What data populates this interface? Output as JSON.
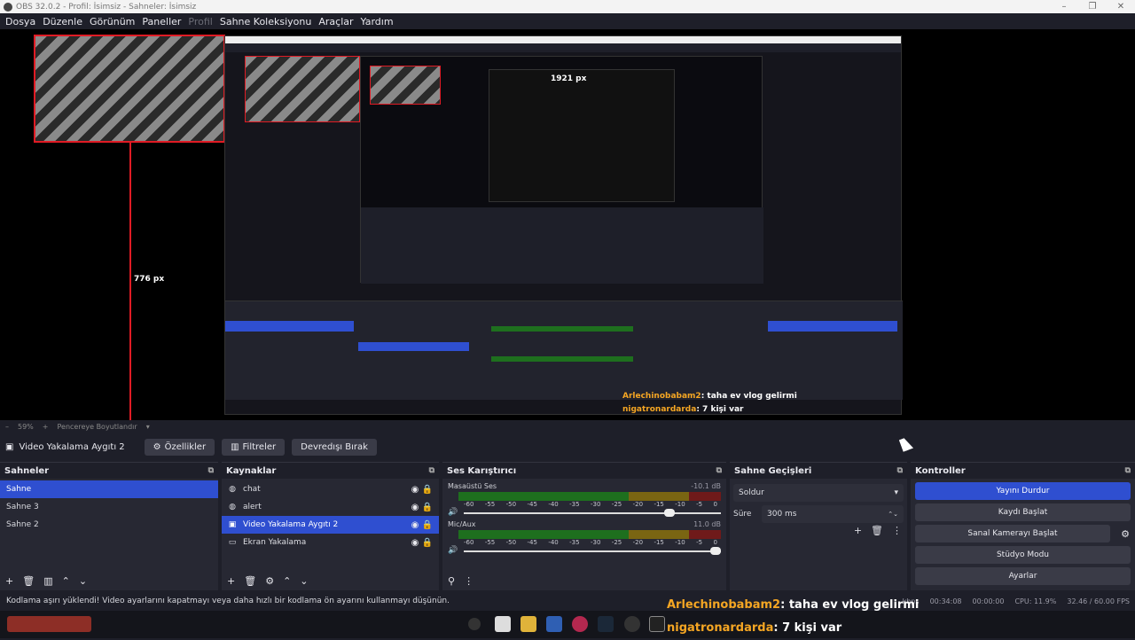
{
  "window": {
    "title": "OBS 32.0.2 - Profil: İsimsiz - Sahneler: İsimsiz"
  },
  "menu": [
    {
      "label": "Dosya",
      "enabled": true
    },
    {
      "label": "Düzenle",
      "enabled": true
    },
    {
      "label": "Görünüm",
      "enabled": true
    },
    {
      "label": "Paneller",
      "enabled": true
    },
    {
      "label": "Profil",
      "enabled": false
    },
    {
      "label": "Sahne Koleksiyonu",
      "enabled": true
    },
    {
      "label": "Araçlar",
      "enabled": true
    },
    {
      "label": "Yardım",
      "enabled": true
    }
  ],
  "preview": {
    "measure_vertical": "776 px",
    "measure_horizontal": "1921 px",
    "chat": [
      {
        "user": "Arlechinobabam2",
        "message": ": taha ev vlog gelirmi"
      },
      {
        "user": "nigatronardarda",
        "message": ": 7 kişi var"
      }
    ]
  },
  "zoom": {
    "percent": "59%",
    "mode": "Pencereye Boyutlandır"
  },
  "source_toolbar": {
    "current_source": "Video Yakalama Aygıtı 2",
    "properties": "Özellikler",
    "filters": "Filtreler",
    "deactivate": "Devredışı Bırak"
  },
  "scenes": {
    "title": "Sahneler",
    "items": [
      "Sahne",
      "Sahne 3",
      "Sahne 2"
    ],
    "selected": 0
  },
  "sources": {
    "title": "Kaynaklar",
    "items": [
      {
        "name": "chat",
        "icon": "globe-icon"
      },
      {
        "name": "alert",
        "icon": "globe-icon"
      },
      {
        "name": "Video Yakalama Aygıtı 2",
        "icon": "camera-icon"
      },
      {
        "name": "Ekran Yakalama",
        "icon": "monitor-icon"
      }
    ],
    "selected": 2
  },
  "mixer": {
    "title": "Ses Karıştırıcı",
    "channels": [
      {
        "name": "Masaüstü Ses",
        "db": "-10.1 dB",
        "fader": 0.82
      },
      {
        "name": "Mic/Aux",
        "db": "11.0 dB",
        "fader": 1.0
      }
    ],
    "ticks": [
      "-60",
      "-55",
      "-50",
      "-45",
      "-40",
      "-35",
      "-30",
      "-25",
      "-20",
      "-15",
      "-10",
      "-5",
      "0"
    ]
  },
  "transitions": {
    "title": "Sahne Geçişleri",
    "type": "Soldur",
    "duration_label": "Süre",
    "duration": "300 ms"
  },
  "controls": {
    "title": "Kontroller",
    "buttons": [
      {
        "label": "Yayını Durdur",
        "active": true
      },
      {
        "label": "Kaydı Başlat",
        "active": false
      },
      {
        "label": "Sanal Kamerayı Başlat",
        "active": false
      },
      {
        "label": "Stüdyo Modu",
        "active": false
      },
      {
        "label": "Ayarlar",
        "active": false
      }
    ]
  },
  "status": {
    "message": "Kodlama aşırı yüklendi! Video ayarlarını kapatmayı veya daha hızlı bir kodlama ön ayarını kullanmayı düşünün.",
    "kbps": "kbps",
    "stream_time": "00:34:08",
    "rec_time": "00:00:00",
    "cpu": "CPU: 11.9%",
    "fps": "32.46 / 60.00 FPS"
  },
  "colors": {
    "accent": "#2f4fd0",
    "alert_red": "#e01b24",
    "chat_user": "#f5a623"
  }
}
